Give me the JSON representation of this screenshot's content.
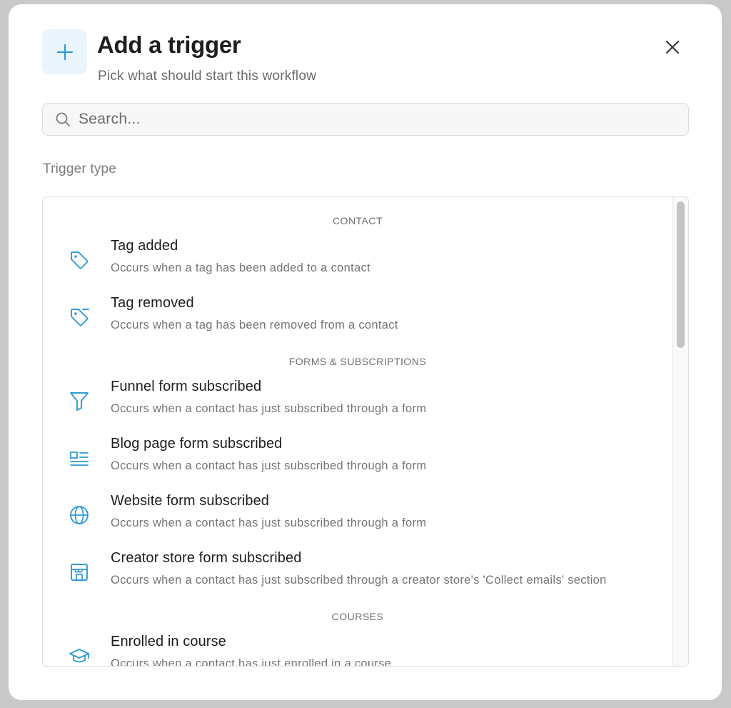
{
  "header": {
    "title": "Add a trigger",
    "subtitle": "Pick what should start this workflow",
    "icon": "plus-icon",
    "close_icon": "close-icon"
  },
  "search": {
    "placeholder": "Search...",
    "value": "",
    "icon": "search-icon"
  },
  "section_label": "Trigger type",
  "groups": [
    {
      "label": "CONTACT",
      "items": [
        {
          "title": "Tag added",
          "description": "Occurs when a tag has been added to a contact",
          "icon": "tag-icon"
        },
        {
          "title": "Tag removed",
          "description": "Occurs when a tag has been removed from a contact",
          "icon": "tag-minus-icon"
        }
      ]
    },
    {
      "label": "FORMS & SUBSCRIPTIONS",
      "items": [
        {
          "title": "Funnel form subscribed",
          "description": "Occurs when a contact has just subscribed through a form",
          "icon": "funnel-icon"
        },
        {
          "title": "Blog page form subscribed",
          "description": "Occurs when a contact has just subscribed through a form",
          "icon": "blog-layout-icon"
        },
        {
          "title": "Website form subscribed",
          "description": "Occurs when a contact has just subscribed through a form",
          "icon": "globe-icon"
        },
        {
          "title": "Creator store form subscribed",
          "description": "Occurs when a contact has just subscribed through a creator store's 'Collect emails' section",
          "icon": "store-icon"
        }
      ]
    },
    {
      "label": "COURSES",
      "items": [
        {
          "title": "Enrolled in course",
          "description": "Occurs when a contact has just enrolled in a course",
          "icon": "graduation-cap-icon"
        }
      ]
    }
  ],
  "colors": {
    "accent": "#2e9bd6",
    "icon_bg": "#eaf4fb",
    "text_primary": "#1e1e1e",
    "text_secondary": "#747474"
  }
}
